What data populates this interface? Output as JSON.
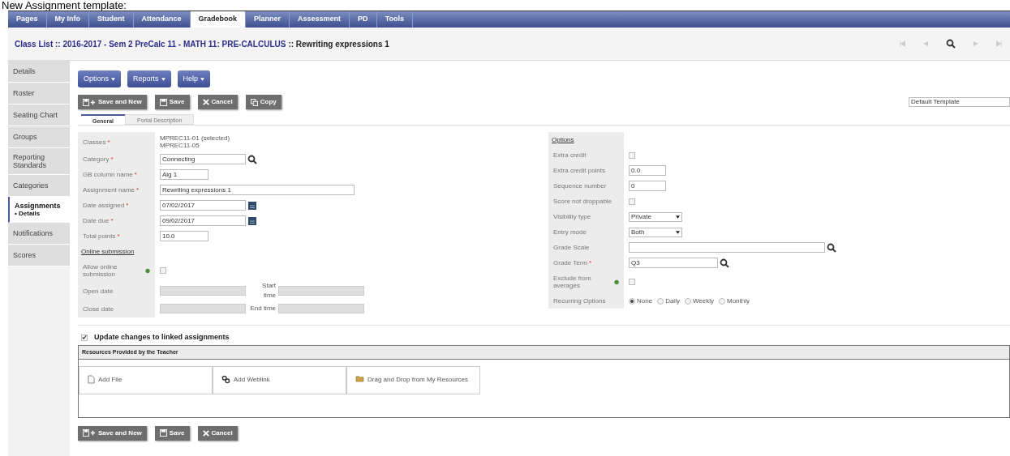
{
  "caption": "New Assignment template:",
  "nav": {
    "tabs": [
      {
        "label": "Pages",
        "selected": false
      },
      {
        "label": "My Info",
        "selected": false
      },
      {
        "label": "Student",
        "selected": false
      },
      {
        "label": "Attendance",
        "selected": false
      },
      {
        "label": "Gradebook",
        "selected": true
      },
      {
        "label": "Planner",
        "selected": false
      },
      {
        "label": "Assessment",
        "selected": false
      },
      {
        "label": "PD",
        "selected": false
      },
      {
        "label": "Tools",
        "selected": false
      }
    ]
  },
  "breadcrumb": {
    "path": "Class List :: 2016-2017 - Sem 2 PreCalc 11 - MATH 11: PRE-CALCULUS",
    "current": ":: Rewriting expressions 1"
  },
  "sidebar": {
    "items": [
      {
        "label": "Details",
        "selected": false
      },
      {
        "label": "Roster",
        "selected": false
      },
      {
        "label": "Seating Chart",
        "selected": false
      },
      {
        "label": "Groups",
        "selected": false
      },
      {
        "label": "Reporting Standards",
        "selected": false
      },
      {
        "label": "Categories",
        "selected": false
      },
      {
        "label": "Assignments",
        "sub": "• Details",
        "selected": true
      },
      {
        "label": "Notifications",
        "selected": false
      },
      {
        "label": "Scores",
        "selected": false
      }
    ]
  },
  "menus": [
    "Options",
    "Reports",
    "Help"
  ],
  "buttons": [
    {
      "kind": "save_new",
      "label": "Save and New"
    },
    {
      "kind": "save",
      "label": "Save"
    },
    {
      "kind": "cancel",
      "label": "Cancel"
    },
    {
      "kind": "copy",
      "label": "Copy"
    }
  ],
  "template_select": {
    "value": "Default Template"
  },
  "form_tabs": [
    {
      "label": "General",
      "selected": true
    },
    {
      "label": "Portal Description",
      "selected": false
    }
  ],
  "form": {
    "left": [
      {
        "kind": "static",
        "label": "Classes",
        "required_mark": "*",
        "lines": [
          "MPREC11-01 (selected)",
          "MPREC11-05"
        ]
      },
      {
        "kind": "lookup",
        "label": "Category",
        "required_mark": "*",
        "value": "Connecting"
      },
      {
        "kind": "input",
        "label": "GB column name",
        "required_mark": "*",
        "value": "Alg 1"
      },
      {
        "kind": "wide_input",
        "label": "Assignment name",
        "required_mark": "*",
        "value": "Rewriting expressions 1"
      },
      {
        "kind": "date",
        "label": "Date assigned",
        "required_mark": "*",
        "value": "07/02/2017"
      },
      {
        "kind": "date",
        "label": "Date due",
        "required_mark": "*",
        "value": "09/02/2017"
      },
      {
        "kind": "input",
        "label": "Total points",
        "required_mark": "*",
        "value": "10.0"
      },
      {
        "kind": "section",
        "label": "Online submission"
      },
      {
        "kind": "checkbox",
        "label": "Allow online submission",
        "help": true,
        "checked": false
      },
      {
        "kind": "range",
        "label": "Open date",
        "label2": "Start time"
      },
      {
        "kind": "range",
        "label": "Close date",
        "label2": "End time"
      }
    ],
    "right": [
      {
        "kind": "section",
        "label": "Options"
      },
      {
        "kind": "checkbox",
        "label": "Extra credit",
        "checked": false
      },
      {
        "kind": "input",
        "label": "Extra credit points",
        "value": "0.0"
      },
      {
        "kind": "input",
        "label": "Sequence number",
        "value": "0"
      },
      {
        "kind": "checkbox",
        "label": "Score not droppable",
        "checked": false
      },
      {
        "kind": "select",
        "label": "Visibility type",
        "value": "Private"
      },
      {
        "kind": "select",
        "label": "Entry mode",
        "value": "Both"
      },
      {
        "kind": "wide_lookup",
        "label": "Grade Scale"
      },
      {
        "kind": "lookup",
        "label": "Grade Term",
        "required_mark": "*",
        "value": "Q3"
      },
      {
        "kind": "checkbox",
        "label": "Exclude from averages",
        "help": true,
        "checked": false
      },
      {
        "kind": "radio",
        "label": "Recurring Options",
        "options": [
          {
            "label": "None",
            "selected": true
          },
          {
            "label": "Daily",
            "selected": false
          },
          {
            "label": "Weekly",
            "selected": false
          },
          {
            "label": "Monthly",
            "selected": false
          }
        ]
      }
    ]
  },
  "linked_update": {
    "label": "Update changes to linked assignments",
    "checked": true
  },
  "resources": {
    "title": "Resources Provided by the Teacher",
    "items": [
      {
        "kind": "file",
        "label": "Add File"
      },
      {
        "kind": "weblink",
        "label": "Add Weblink"
      },
      {
        "kind": "drag",
        "label": "Drag and Drop from My Resources"
      }
    ]
  },
  "bottom_buttons": [
    {
      "kind": "save_new",
      "label": "Save and New"
    },
    {
      "kind": "save",
      "label": "Save"
    },
    {
      "kind": "cancel",
      "label": "Cancel"
    }
  ]
}
